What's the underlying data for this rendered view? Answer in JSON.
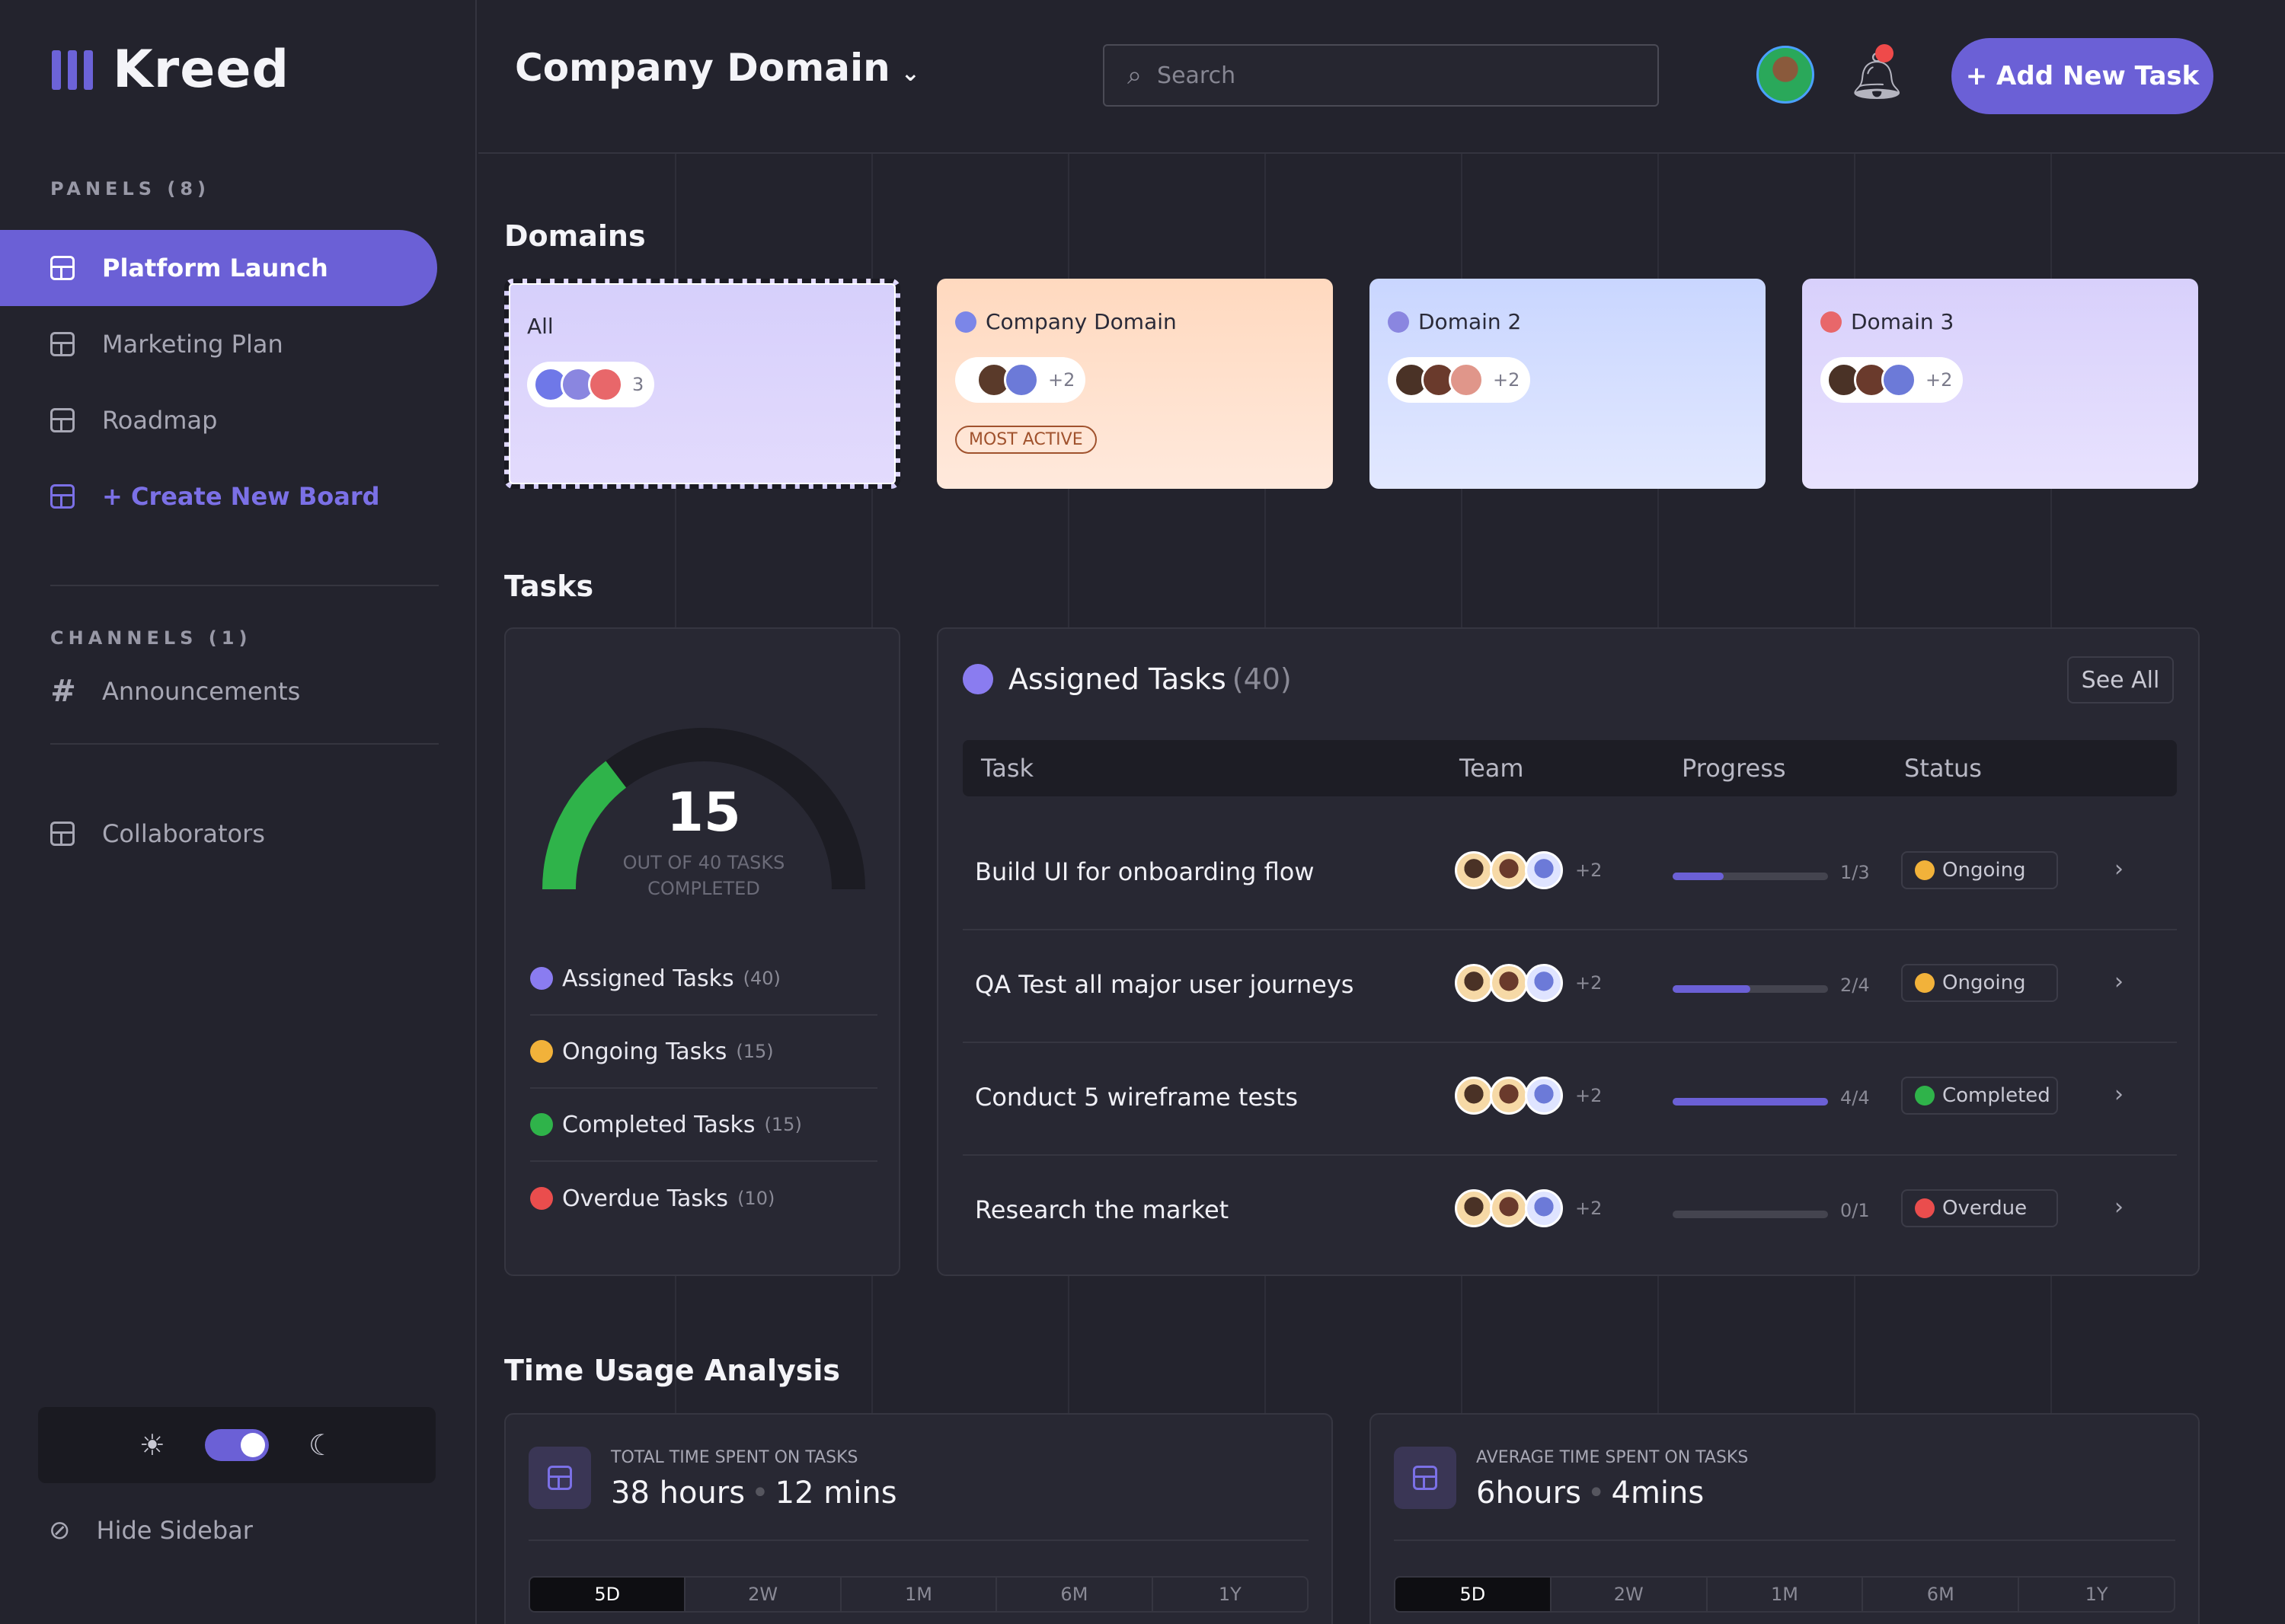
{
  "app": {
    "name": "Kreed"
  },
  "sidebar": {
    "panels_label": "PANELS (8)",
    "items": [
      {
        "label": "Platform Launch"
      },
      {
        "label": "Marketing Plan"
      },
      {
        "label": "Roadmap"
      },
      {
        "label": "+ Create New Board"
      }
    ],
    "channels_label": "CHANNELS (1)",
    "channels": [
      {
        "label": "Announcements"
      }
    ],
    "collaborators_label": "Collaborators",
    "hide_label": "Hide Sidebar",
    "theme": {
      "sun": "☀",
      "moon": "☾"
    }
  },
  "header": {
    "title": "Company Domain",
    "search_placeholder": "Search",
    "add_task_label": "+ Add New Task"
  },
  "domains": {
    "title": "Domains",
    "cards": [
      {
        "name": "All",
        "count": "3"
      },
      {
        "name": "Company Domain",
        "count": "+2",
        "badge": "MOST ACTIVE"
      },
      {
        "name": "Domain 2",
        "count": "+2"
      },
      {
        "name": "Domain 3",
        "count": "+2"
      }
    ]
  },
  "tasks": {
    "title": "Tasks",
    "summary": {
      "completed": 15,
      "total": 40,
      "caption_line1": "OUT OF 40 TASKS",
      "caption_line2": "COMPLETED",
      "completed_fraction": 0.375,
      "legend": [
        {
          "label": "Assigned Tasks",
          "count": "(40)",
          "color": "#8a7cf0"
        },
        {
          "label": "Ongoing Tasks",
          "count": "(15)",
          "color": "#f2b23a"
        },
        {
          "label": "Completed Tasks",
          "count": "(15)",
          "color": "#2fb34a"
        },
        {
          "label": "Overdue Tasks",
          "count": "(10)",
          "color": "#ea4d4d"
        }
      ]
    },
    "assigned": {
      "title": "Assigned Tasks",
      "count": "(40)",
      "see_all": "See All",
      "columns": [
        "Task",
        "Team",
        "Progress",
        "Status"
      ],
      "rows": [
        {
          "task": "Build UI for onboarding flow",
          "team_more": "+2",
          "progress": "1/3",
          "fraction": 0.33,
          "status": "Ongoing",
          "status_color": "#f2b23a"
        },
        {
          "task": "QA Test all major user journeys",
          "team_more": "+2",
          "progress": "2/4",
          "fraction": 0.5,
          "status": "Ongoing",
          "status_color": "#f2b23a"
        },
        {
          "task": "Conduct 5 wireframe tests",
          "team_more": "+2",
          "progress": "4/4",
          "fraction": 1.0,
          "status": "Completed",
          "status_color": "#2fb34a"
        },
        {
          "task": "Research the market",
          "team_more": "+2",
          "progress": "0/1",
          "fraction": 0.0,
          "status": "Overdue",
          "status_color": "#ea4d4d"
        }
      ]
    }
  },
  "time_usage": {
    "title": "Time Usage Analysis",
    "cards": [
      {
        "label": "TOTAL TIME SPENT ON TASKS",
        "value_a": "38 hours",
        "value_b": "12 mins"
      },
      {
        "label": "AVERAGE TIME SPENT ON TASKS",
        "value_a": "6hours",
        "value_b": "4mins"
      }
    ],
    "ranges": [
      "5D",
      "2W",
      "1M",
      "6M",
      "1Y"
    ],
    "selected_range": "5D"
  },
  "colors": {
    "accent": "#6b60d6",
    "bg": "#23232d"
  }
}
